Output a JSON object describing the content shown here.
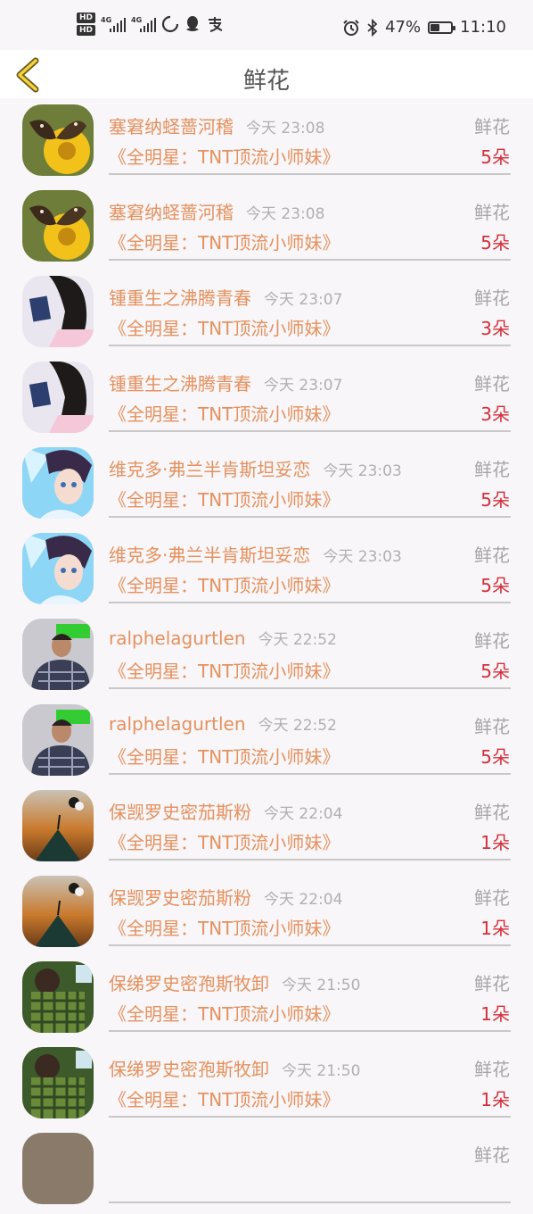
{
  "status_bar": {
    "hd1": "HD",
    "hd2": "HD",
    "net1": "4G",
    "net2": "4G",
    "battery_percent": "47%",
    "battery_level": 0.47,
    "time": "11:10"
  },
  "header": {
    "title": "鲜花"
  },
  "rows": [
    {
      "user": "塞窘纳蛏蔷河稽",
      "time": "今天 23:08",
      "gift": "鲜花",
      "work": "《全明星：TNT顶流小师妹》",
      "count": "5朵",
      "avatar": "butterfly"
    },
    {
      "user": "塞窘纳蛏蔷河稽",
      "time": "今天 23:08",
      "gift": "鲜花",
      "work": "《全明星：TNT顶流小师妹》",
      "count": "5朵",
      "avatar": "butterfly"
    },
    {
      "user": "锺重生之沸腾青春",
      "time": "今天 23:07",
      "gift": "鲜花",
      "work": "《全明星：TNT顶流小师妹》",
      "count": "3朵",
      "avatar": "girl"
    },
    {
      "user": "锺重生之沸腾青春",
      "time": "今天 23:07",
      "gift": "鲜花",
      "work": "《全明星：TNT顶流小师妹》",
      "count": "3朵",
      "avatar": "girl"
    },
    {
      "user": "维克多·弗兰半肯斯坦妥恋",
      "time": "今天 23:03",
      "gift": "鲜花",
      "work": "《全明星：TNT顶流小师妹》",
      "count": "5朵",
      "avatar": "anime"
    },
    {
      "user": "维克多·弗兰半肯斯坦妥恋",
      "time": "今天 23:03",
      "gift": "鲜花",
      "work": "《全明星：TNT顶流小师妹》",
      "count": "5朵",
      "avatar": "anime"
    },
    {
      "user": "ralphelagurtlen",
      "time": "今天 22:52",
      "gift": "鲜花",
      "work": "《全明星：TNT顶流小师妹》",
      "count": "5朵",
      "avatar": "man"
    },
    {
      "user": "ralphelagurtlen",
      "time": "今天 22:52",
      "gift": "鲜花",
      "work": "《全明星：TNT顶流小师妹》",
      "count": "5朵",
      "avatar": "man"
    },
    {
      "user": "保觊罗史密茄斯粉",
      "time": "今天 22:04",
      "gift": "鲜花",
      "work": "《全明星：TNT顶流小师妹》",
      "count": "1朵",
      "avatar": "sunset"
    },
    {
      "user": "保觊罗史密茄斯粉",
      "time": "今天 22:04",
      "gift": "鲜花",
      "work": "《全明星：TNT顶流小师妹》",
      "count": "1朵",
      "avatar": "sunset"
    },
    {
      "user": "保绨罗史密孢斯牧卸",
      "time": "今天 21:50",
      "gift": "鲜花",
      "work": "《全明星：TNT顶流小师妹》",
      "count": "1朵",
      "avatar": "plaid"
    },
    {
      "user": "保绨罗史密孢斯牧卸",
      "time": "今天 21:50",
      "gift": "鲜花",
      "work": "《全明星：TNT顶流小师妹》",
      "count": "1朵",
      "avatar": "plaid"
    },
    {
      "user": "",
      "time": "",
      "gift": "鲜花",
      "work": "",
      "count": "",
      "avatar": "partial"
    }
  ]
}
